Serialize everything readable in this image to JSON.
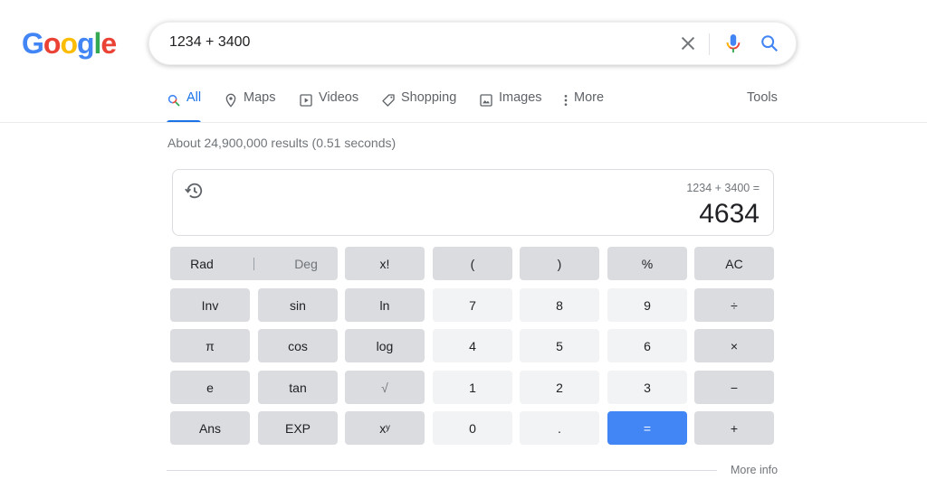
{
  "logo": {
    "letters": [
      {
        "ch": "G",
        "color": "#4285f4"
      },
      {
        "ch": "o",
        "color": "#ea4335"
      },
      {
        "ch": "o",
        "color": "#fbbc05"
      },
      {
        "ch": "g",
        "color": "#4285f4"
      },
      {
        "ch": "l",
        "color": "#34a853"
      },
      {
        "ch": "e",
        "color": "#ea4335"
      }
    ]
  },
  "search": {
    "query": "1234 + 3400",
    "icons": [
      "clear-icon",
      "mic-icon",
      "search-icon"
    ]
  },
  "tabs": [
    {
      "label": "All",
      "icon": "search-icon",
      "active": true
    },
    {
      "label": "Maps",
      "icon": "map-pin-icon"
    },
    {
      "label": "Videos",
      "icon": "play-icon"
    },
    {
      "label": "Shopping",
      "icon": "tag-icon"
    },
    {
      "label": "Images",
      "icon": "image-icon"
    },
    {
      "label": "More",
      "icon": "more-vert-icon"
    }
  ],
  "tools_label": "Tools",
  "result_stats": "About 24,900,000 results (0.51 seconds)",
  "calculator": {
    "expression": "1234 + 3400 =",
    "result": "4634",
    "keys": {
      "rad": "Rad",
      "deg": "Deg",
      "fact": "x!",
      "lparen": "(",
      "rparen": ")",
      "percent": "%",
      "ac": "AC",
      "inv": "Inv",
      "sin": "sin",
      "ln": "ln",
      "k7": "7",
      "k8": "8",
      "k9": "9",
      "divide": "÷",
      "pi": "π",
      "cos": "cos",
      "log": "log",
      "k4": "4",
      "k5": "5",
      "k6": "6",
      "multiply": "×",
      "e": "e",
      "tan": "tan",
      "sqrt": "√",
      "k1": "1",
      "k2": "2",
      "k3": "3",
      "minus": "−",
      "ans": "Ans",
      "exp": "EXP",
      "pow": "xʸ",
      "k0": "0",
      "dot": ".",
      "equals": "=",
      "plus": "+"
    }
  },
  "more_info": "More info",
  "colors": {
    "accent": "#1a73e8",
    "equals_key": "#4285f4",
    "op_key": "#dadce0",
    "num_key": "#f1f3f4"
  }
}
